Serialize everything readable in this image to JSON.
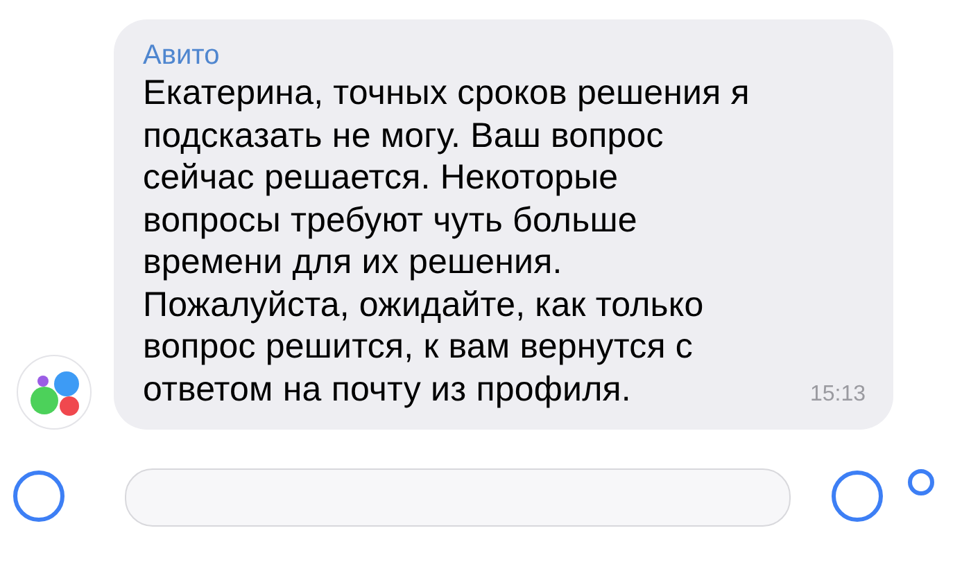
{
  "message": {
    "sender": "Авито",
    "text": "Екатерина, точных сроков решения я\nподсказать не могу. Ваш вопрос\nсейчас решается. Некоторые\nвопросы требуют чуть больше\nвремени для их решения.\nПожалуйста, ожидайте, как только\nвопрос решится, к вам вернутся с\nответом на почту из профиля.",
    "time": "15:13"
  }
}
